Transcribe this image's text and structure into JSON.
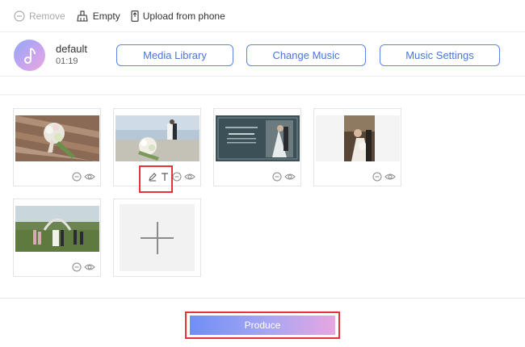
{
  "toolbar": {
    "remove_label": "Remove",
    "empty_label": "Empty",
    "upload_label": "Upload from phone"
  },
  "music": {
    "title": "default",
    "duration": "01:19",
    "media_library_label": "Media Library",
    "change_music_label": "Change Music",
    "music_settings_label": "Music Settings"
  },
  "photos": [
    {
      "subject": "wedding bouquet on wooden planks"
    },
    {
      "subject": "bride and groom by the sea with bouquet",
      "edit_icons_visible": true
    },
    {
      "subject": "wedding video title card"
    },
    {
      "subject": "couple portrait with flowers"
    },
    {
      "subject": "outdoor wedding ceremony under arch"
    }
  ],
  "footer": {
    "produce_label": "Produce"
  },
  "colors": {
    "accent_blue": "#4a76d9",
    "highlight_red": "#e8323a",
    "gradient_start": "#6f8ff5",
    "gradient_end": "#e8a6e2"
  }
}
